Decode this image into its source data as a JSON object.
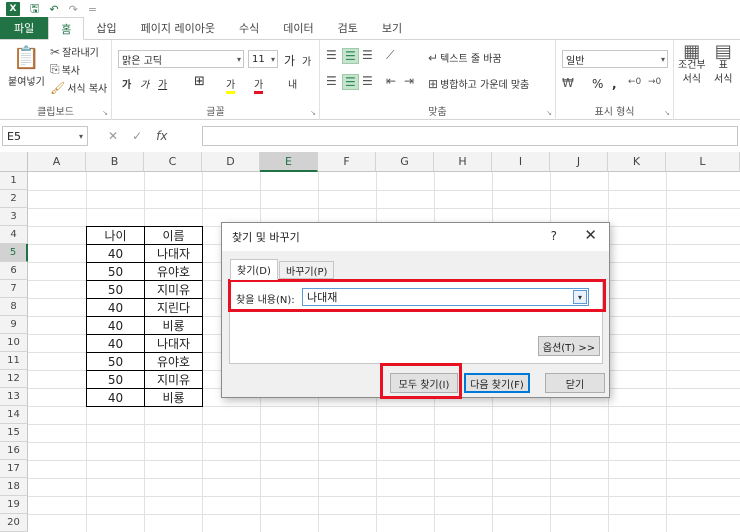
{
  "titlebar": {
    "logo": "X",
    "save_icon": "save-icon",
    "undo": "↶",
    "redo": "↷",
    "customize": "="
  },
  "tabs": [
    "파일",
    "홈",
    "삽입",
    "페이지 레이아웃",
    "수식",
    "데이터",
    "검토",
    "보기"
  ],
  "ribbon": {
    "clipboard": {
      "paste": "붙여넣기",
      "cut": "잘라내기",
      "copy": "복사",
      "format_painter": "서식 복사",
      "label": "클립보드"
    },
    "font": {
      "name": "맑은 고딕",
      "size": "11",
      "grow": "가",
      "shrink": "가",
      "bold": "가",
      "italic": "가",
      "underline": "가",
      "border": "⊞",
      "fill": "가",
      "color": "가",
      "phonetic": "내",
      "label": "글꼴"
    },
    "align": {
      "wrap": "텍스트 줄 바꿈",
      "merge": "병합하고 가운데 맞춤",
      "label": "맞춤"
    },
    "number": {
      "format": "일반",
      "percent": "%",
      "comma": ",",
      "label": "표시 형식"
    },
    "styles": {
      "conditional": "조건부",
      "conditional2": "서식",
      "table": "표",
      "table2": "서식"
    }
  },
  "formulabar": {
    "namebox": "E5",
    "cancel": "✕",
    "enter": "✓",
    "fx": "fx"
  },
  "columns": [
    "A",
    "B",
    "C",
    "D",
    "E",
    "F",
    "G",
    "H",
    "I",
    "J",
    "K",
    "L"
  ],
  "rows": [
    "1",
    "2",
    "3",
    "4",
    "5",
    "6",
    "7",
    "8",
    "9",
    "10",
    "11",
    "12",
    "13",
    "14",
    "15",
    "16",
    "17",
    "18",
    "19",
    "20"
  ],
  "table": {
    "header": {
      "age": "나이",
      "name": "이름"
    },
    "data": [
      {
        "age": "40",
        "name": "나대자"
      },
      {
        "age": "50",
        "name": "유야호"
      },
      {
        "age": "50",
        "name": "지미유"
      },
      {
        "age": "40",
        "name": "지린다"
      },
      {
        "age": "40",
        "name": "비룡"
      },
      {
        "age": "40",
        "name": "나대자"
      },
      {
        "age": "50",
        "name": "유야호"
      },
      {
        "age": "50",
        "name": "지미유"
      },
      {
        "age": "40",
        "name": "비룡"
      }
    ]
  },
  "dialog": {
    "title": "찾기 및 바꾸기",
    "help": "?",
    "close": "✕",
    "tab_find": "찾기(D)",
    "tab_replace": "바꾸기(P)",
    "find_label": "찾을 내용(N):",
    "find_value": "나대재",
    "options": "옵션(T) >>",
    "find_all": "모두 찾기(I)",
    "find_next": "다음 찾기(F)",
    "close_btn": "닫기"
  }
}
